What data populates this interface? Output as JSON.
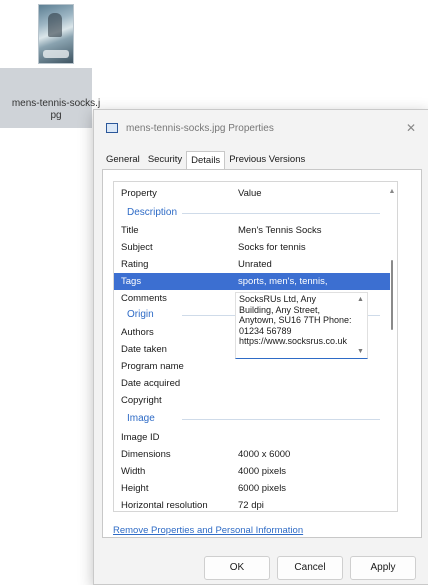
{
  "desktop": {
    "file_name": "mens-tennis-socks.jpg"
  },
  "dialog": {
    "title": "mens-tennis-socks.jpg Properties",
    "close_glyph": "✕",
    "tabs": [
      "General",
      "Security",
      "Details",
      "Previous Versions"
    ],
    "active_tab": "Details",
    "header": {
      "property": "Property",
      "value": "Value"
    },
    "sections": {
      "description": "Description",
      "origin": "Origin",
      "image": "Image"
    },
    "description_rows": [
      {
        "k": "Title",
        "v": "Men's Tennis Socks"
      },
      {
        "k": "Subject",
        "v": "Socks for tennis"
      },
      {
        "k": "Rating",
        "v": "Unrated"
      },
      {
        "k": "Tags",
        "v": "sports, men's, tennis,"
      },
      {
        "k": "Comments",
        "v": ""
      }
    ],
    "comments_text": "SocksRUs Ltd, Any Building, Any Street, Anytown, SU16 7TH Phone: 01234 56789 https://www.socksrus.co.uk",
    "origin_rows": [
      {
        "k": "Authors",
        "v": ""
      },
      {
        "k": "Date taken",
        "v": ""
      },
      {
        "k": "Program name",
        "v": ""
      },
      {
        "k": "Date acquired",
        "v": ""
      },
      {
        "k": "Copyright",
        "v": ""
      }
    ],
    "image_rows": [
      {
        "k": "Image ID",
        "v": ""
      },
      {
        "k": "Dimensions",
        "v": "4000 x 6000"
      },
      {
        "k": "Width",
        "v": "4000 pixels"
      },
      {
        "k": "Height",
        "v": "6000 pixels"
      },
      {
        "k": "Horizontal resolution",
        "v": "72 dpi"
      }
    ],
    "remove_link": "Remove Properties and Personal Information",
    "buttons": {
      "ok": "OK",
      "cancel": "Cancel",
      "apply": "Apply"
    }
  },
  "icons": {
    "scroll_up": "▲",
    "scroll_down": "▼"
  },
  "colors": {
    "selection": "#3c6fd1",
    "section_heading": "#2e6bc6",
    "link": "#2e6bc6"
  }
}
